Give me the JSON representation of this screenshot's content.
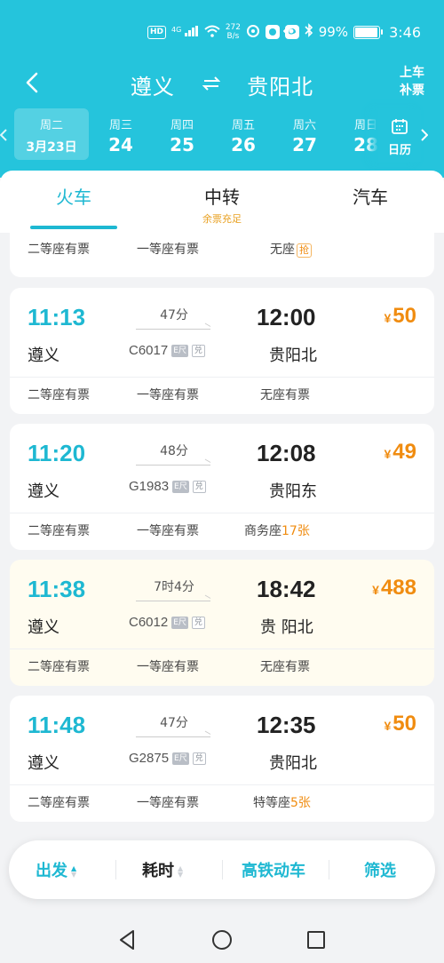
{
  "status_bar": {
    "hd": "HD",
    "network": "4G",
    "speed_value": "272",
    "speed_unit": "B/s",
    "battery": "99%",
    "time": "3:46"
  },
  "header": {
    "from": "遵义",
    "to": "贵阳北",
    "ticket_line1": "上车",
    "ticket_line2": "补票"
  },
  "dates": [
    {
      "weekday": "周二",
      "date": "3月23日",
      "active": true
    },
    {
      "weekday": "周三",
      "date": "24"
    },
    {
      "weekday": "周四",
      "date": "25"
    },
    {
      "weekday": "周五",
      "date": "26"
    },
    {
      "weekday": "周六",
      "date": "27"
    },
    {
      "weekday": "周日",
      "date": "28"
    }
  ],
  "calendar_label": "日历",
  "tabs": [
    {
      "label": "火车",
      "active": true
    },
    {
      "label": "中转",
      "sub": "余票充足"
    },
    {
      "label": "汽车"
    }
  ],
  "partial_card": {
    "seats": [
      "二等座有票",
      "一等座有票",
      "无座"
    ],
    "grab": "抢"
  },
  "trains": [
    {
      "dep_time": "11:13",
      "arr_time": "12:00",
      "price_symbol": "¥",
      "price": "50",
      "duration": "47分",
      "train_no": "C6017",
      "badge1": "E尺",
      "badge2": "兑",
      "dep_station": "遵义",
      "arr_station": "贵阳北",
      "seats": [
        {
          "text": "二等座有票"
        },
        {
          "text": "一等座有票"
        },
        {
          "text": "无座有票"
        }
      ]
    },
    {
      "dep_time": "11:20",
      "arr_time": "12:08",
      "price_symbol": "¥",
      "price": "49",
      "duration": "48分",
      "train_no": "G1983",
      "badge1": "E尺",
      "badge2": "兑",
      "dep_station": "遵义",
      "arr_station": "贵阳东",
      "seats": [
        {
          "text": "二等座有票"
        },
        {
          "text": "一等座有票"
        },
        {
          "text": "商务座",
          "count": "17张"
        }
      ]
    },
    {
      "dep_time": "11:38",
      "arr_time": "18:42",
      "price_symbol": "¥",
      "price": "488",
      "duration": "7时4分",
      "train_no": "C6012",
      "badge1": "E尺",
      "badge2": "兑",
      "dep_station": "遵义",
      "arr_station": "贵 阳北",
      "highlight": true,
      "seats": [
        {
          "text": "二等座有票"
        },
        {
          "text": "一等座有票"
        },
        {
          "text": "无座有票"
        }
      ]
    },
    {
      "dep_time": "11:48",
      "arr_time": "12:35",
      "price_symbol": "¥",
      "price": "50",
      "duration": "47分",
      "train_no": "G2875",
      "badge1": "E尺",
      "badge2": "兑",
      "dep_station": "遵义",
      "arr_station": "贵阳北",
      "seats": [
        {
          "text": "二等座有票"
        },
        {
          "text": "一等座有票"
        },
        {
          "text": "特等座",
          "count": "5张"
        }
      ]
    }
  ],
  "filter_bar": {
    "depart": "出发",
    "duration": "耗时",
    "high_speed": "高铁动车",
    "filter": "筛选"
  },
  "colors": {
    "brand_teal": "#25c4dc",
    "accent_teal": "#1eb8d2",
    "price_orange": "#f08c10",
    "highlight_bg": "#fffcf0"
  }
}
